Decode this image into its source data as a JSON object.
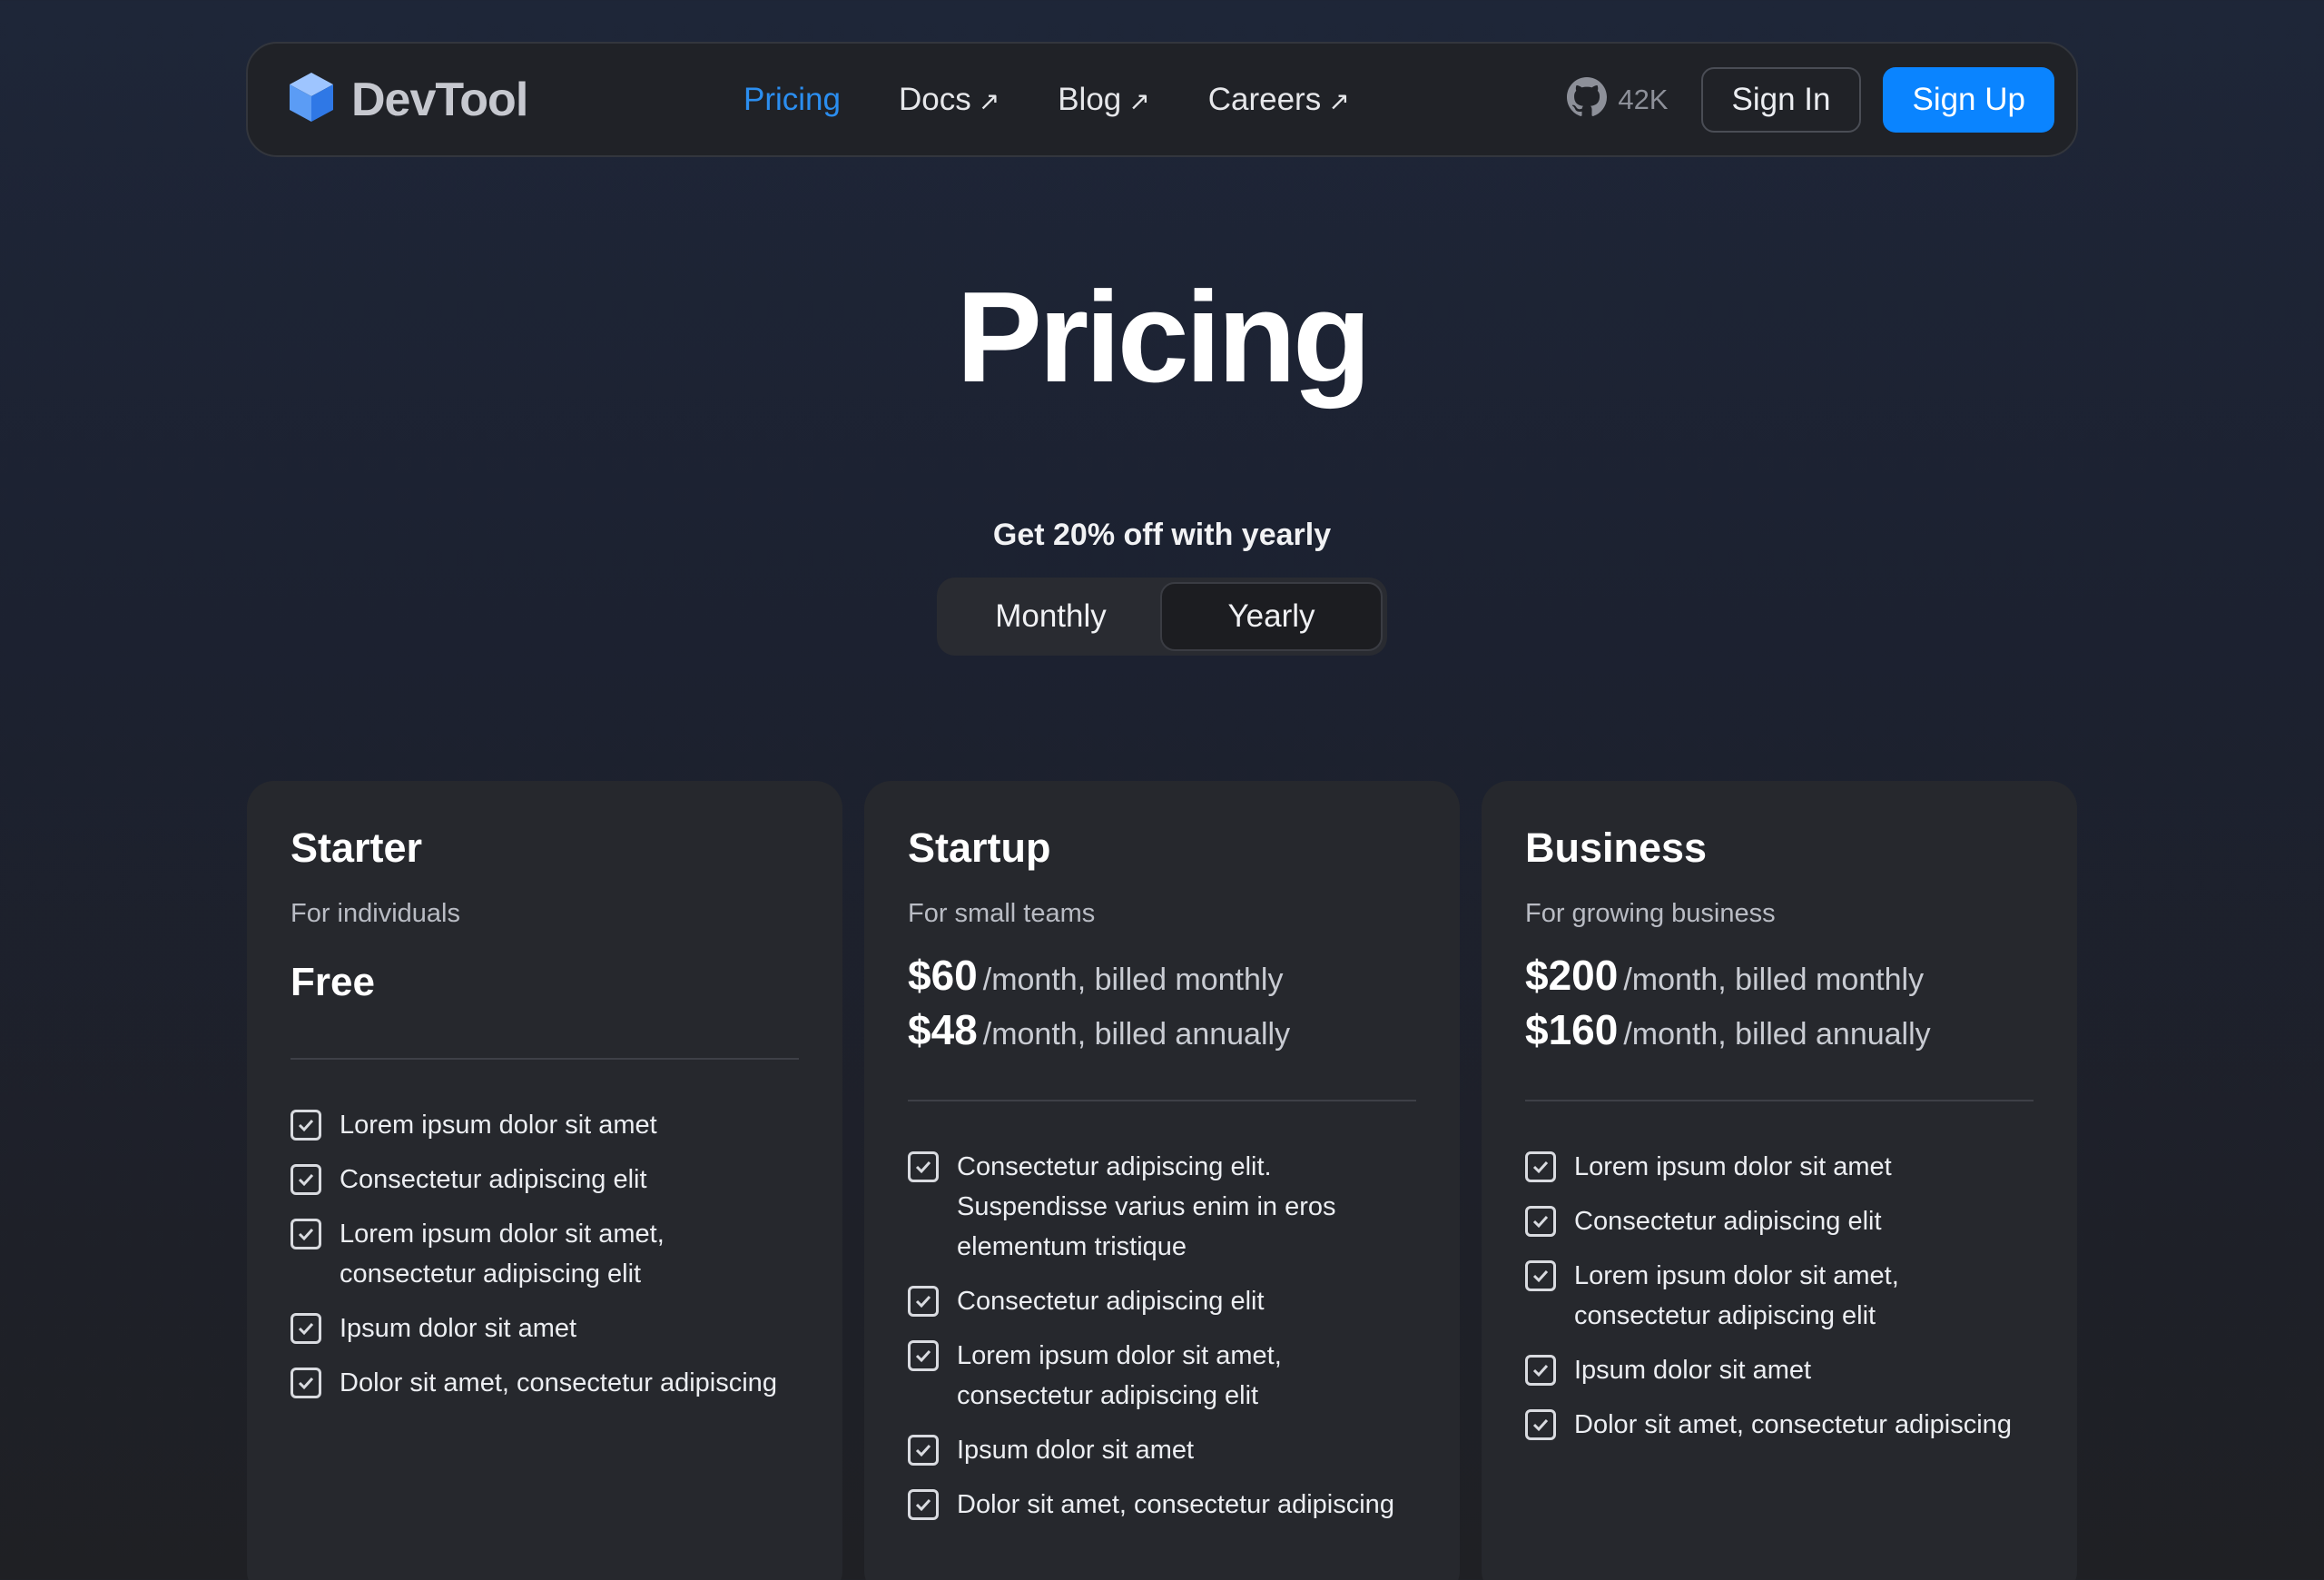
{
  "nav": {
    "brand": "DevTool",
    "links": [
      {
        "label": "Pricing",
        "external": false,
        "active": true
      },
      {
        "label": "Docs",
        "external": true
      },
      {
        "label": "Blog",
        "external": true
      },
      {
        "label": "Careers",
        "external": true
      }
    ],
    "external_icon": "↗",
    "github_stars": "42K",
    "signin_label": "Sign In",
    "signup_label": "Sign Up"
  },
  "hero": {
    "title": "Pricing",
    "discount_text": "Get 20% off with yearly",
    "toggle": {
      "monthly": "Monthly",
      "yearly": "Yearly",
      "selected": "yearly"
    }
  },
  "plans": [
    {
      "name": "Starter",
      "subtitle": "For individuals",
      "price_free": "Free",
      "features": [
        "Lorem ipsum dolor sit amet",
        "Consectetur adipiscing elit",
        "Lorem ipsum dolor sit amet, consectetur adipiscing elit",
        "Ipsum dolor sit amet",
        "Dolor sit amet, consectetur adipiscing"
      ]
    },
    {
      "name": "Startup",
      "subtitle": "For small teams",
      "monthly_amount": "$60",
      "monthly_suffix": "/month, billed monthly",
      "annual_amount": "$48",
      "annual_suffix": "/month, billed annually",
      "features": [
        "Consectetur adipiscing elit. Suspendisse varius enim in eros elementum tristique",
        "Consectetur adipiscing elit",
        "Lorem ipsum dolor sit amet, consectetur adipiscing elit",
        "Ipsum dolor sit amet",
        "Dolor sit amet, consectetur adipiscing"
      ]
    },
    {
      "name": "Business",
      "subtitle": "For growing business",
      "monthly_amount": "$200",
      "monthly_suffix": "/month, billed monthly",
      "annual_amount": "$160",
      "annual_suffix": "/month, billed annually",
      "features": [
        "Lorem ipsum dolor sit amet",
        "Consectetur adipiscing elit",
        "Lorem ipsum dolor sit amet, consectetur adipiscing elit",
        "Ipsum dolor sit amet",
        "Dolor sit amet, consectetur adipiscing"
      ]
    }
  ],
  "colors": {
    "accent": "#0a84ff",
    "active_link": "#2b8ef0",
    "card_bg": "#26282d",
    "nav_bg": "#202227"
  },
  "icons": [
    "cube-logo-icon",
    "external-link-icon",
    "github-icon",
    "checkbox-checked-icon"
  ]
}
